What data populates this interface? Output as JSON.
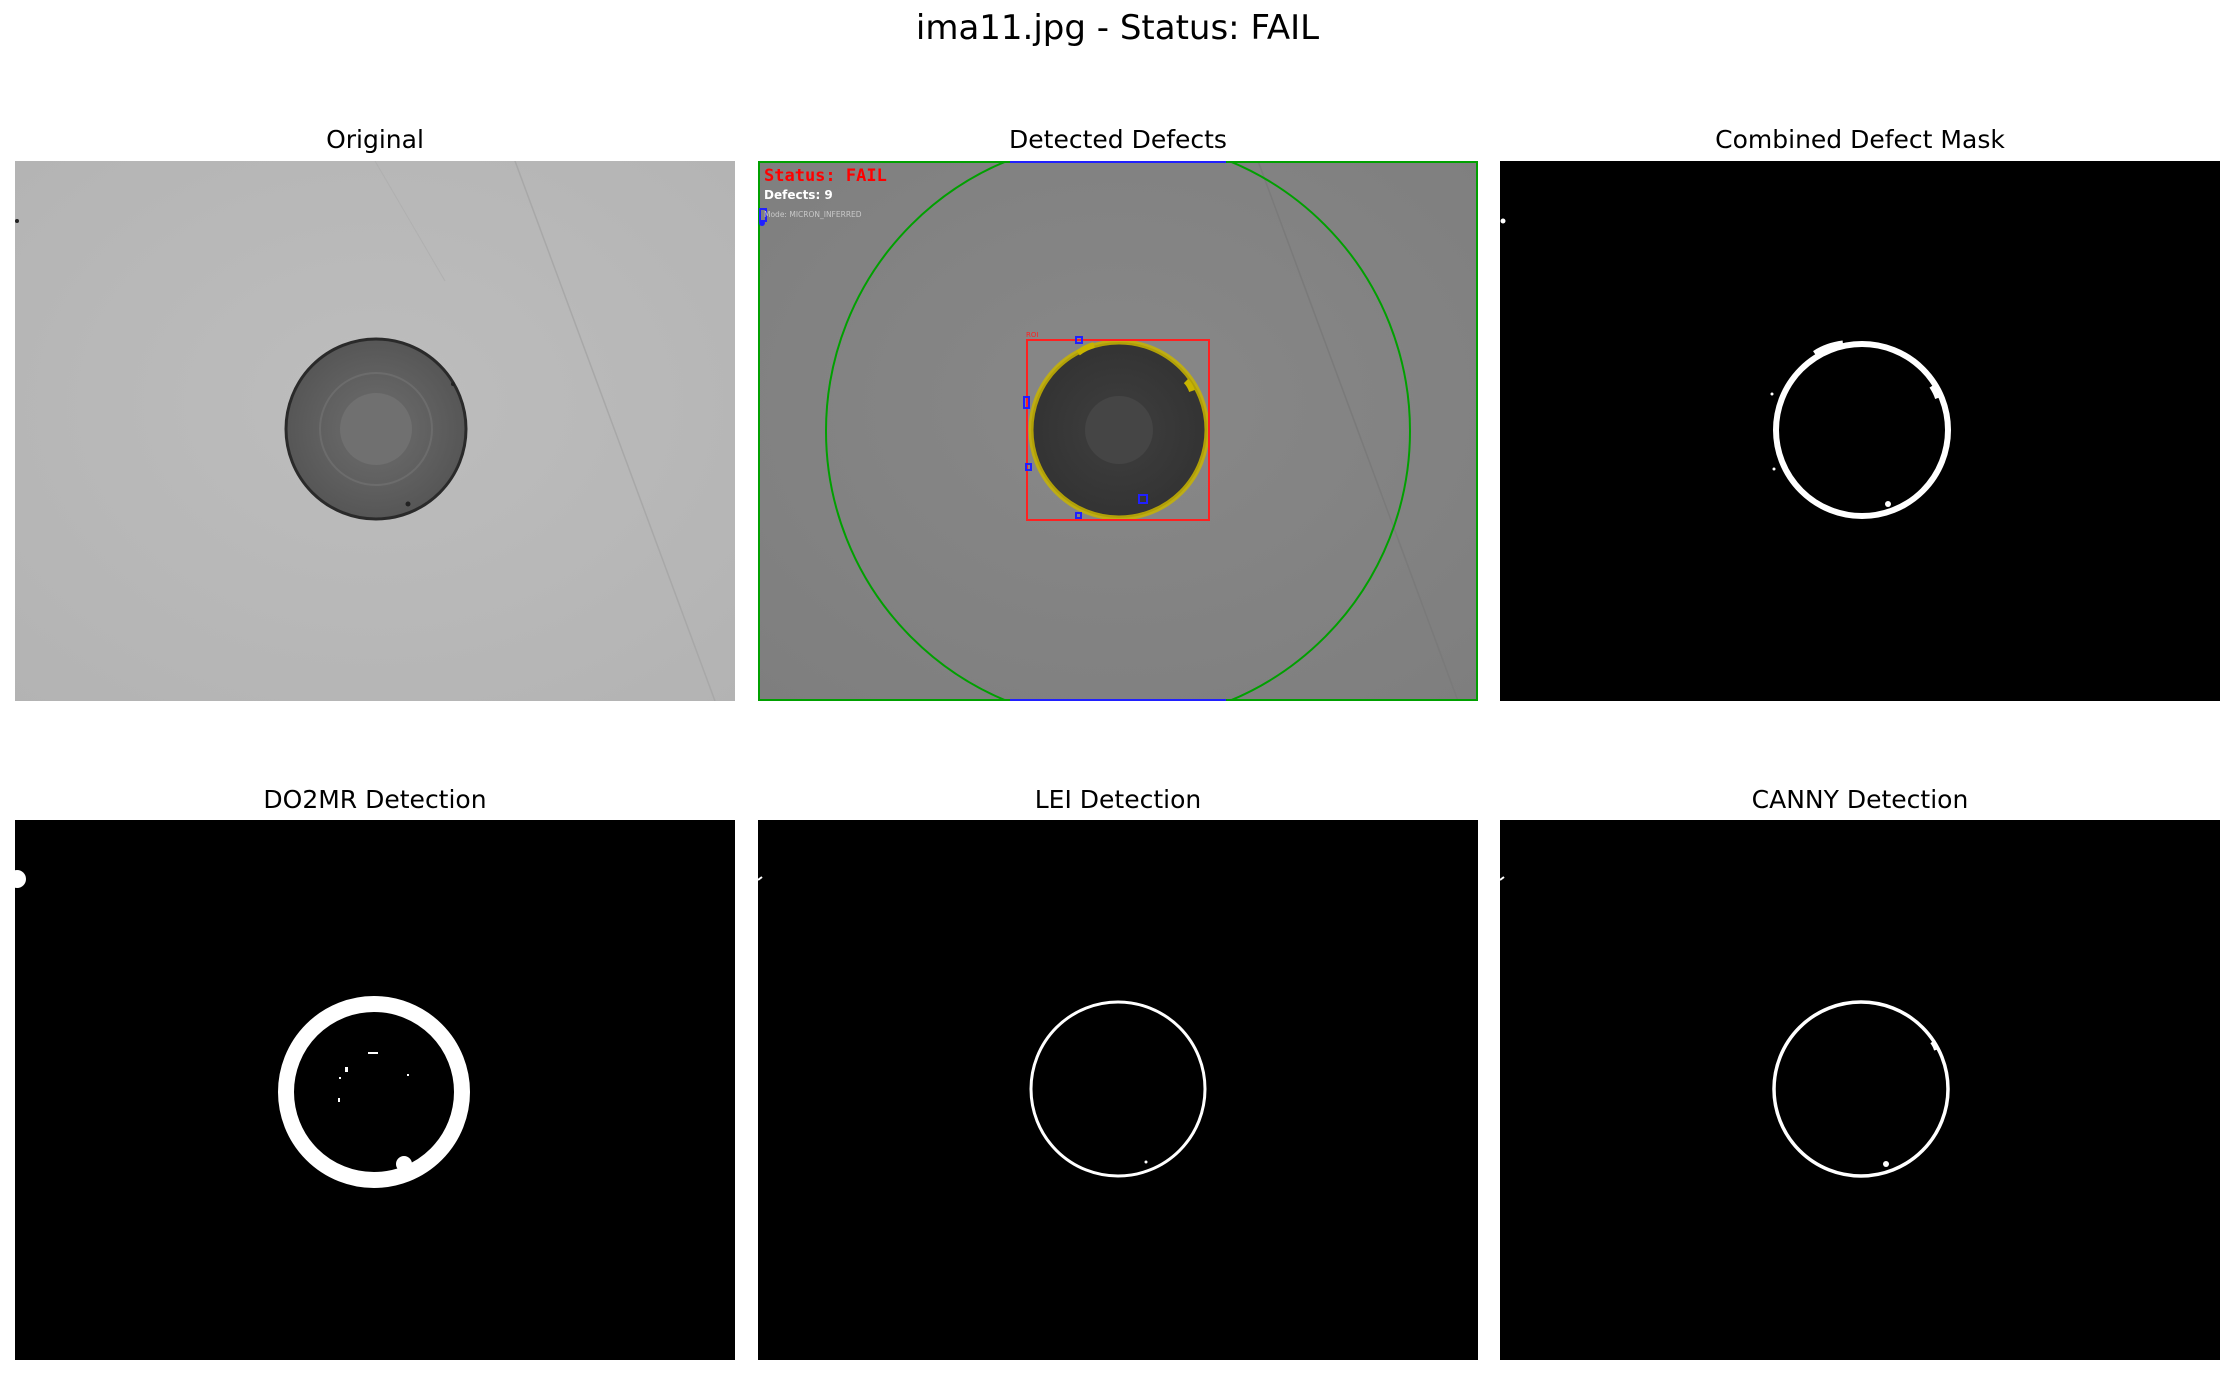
{
  "figure": {
    "title": "ima11.jpg - Status: FAIL"
  },
  "panels": {
    "original": {
      "title": "Original"
    },
    "detected": {
      "title": "Detected Defects",
      "overlay": {
        "status_text": "Status: FAIL",
        "defects_text": "Defects: 9",
        "mode_text": "Mode: MICRON_INFERRED"
      }
    },
    "combined_mask": {
      "title": "Combined Defect Mask"
    },
    "do2mr": {
      "title": "DO2MR Detection"
    },
    "lei": {
      "title": "LEI Detection"
    },
    "canny": {
      "title": "CANNY Detection"
    }
  },
  "colors": {
    "status_fail": "#ff0000",
    "cladding_circle": "#00a000",
    "core_region": "#c8b400",
    "bbox": "#ff2020",
    "defect_box": "#2020ff",
    "mask_bg": "#000000",
    "mask_fg": "#ffffff"
  }
}
